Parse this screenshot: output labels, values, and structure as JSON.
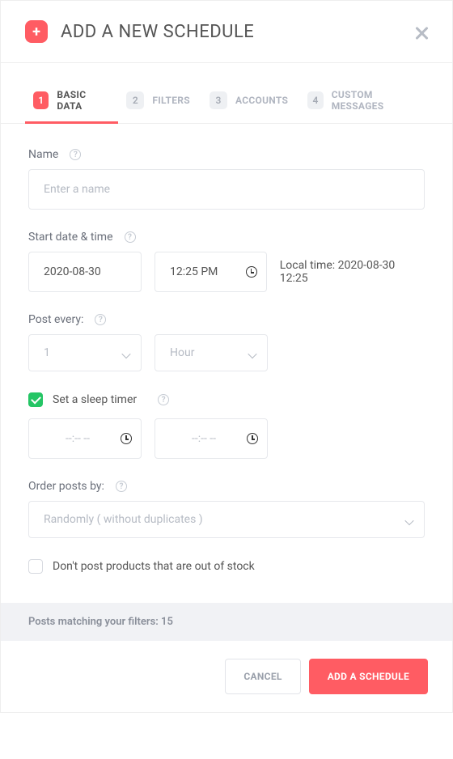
{
  "header": {
    "title": "ADD A NEW SCHEDULE"
  },
  "tabs": [
    {
      "num": "1",
      "label": "BASIC DATA",
      "active": true
    },
    {
      "num": "2",
      "label": "FILTERS"
    },
    {
      "num": "3",
      "label": "ACCOUNTS"
    },
    {
      "num": "4",
      "label": "CUSTOM MESSAGES"
    }
  ],
  "name": {
    "label": "Name",
    "placeholder": "Enter a name",
    "value": ""
  },
  "start": {
    "label": "Start date & time",
    "date_value": "2020-08-30",
    "time_value": "12:25 PM",
    "local_time": "Local time: 2020-08-30 12:25"
  },
  "post_every": {
    "label": "Post every:",
    "interval": "1",
    "unit": "Hour"
  },
  "sleep": {
    "label": "Set a sleep timer",
    "checked": true,
    "from_placeholder": "--:-- --",
    "to_placeholder": "--:-- --"
  },
  "order": {
    "label": "Order posts by:",
    "selected": "Randomly ( without duplicates )"
  },
  "outofstock": {
    "label": "Don't post products that are out of stock",
    "checked": false
  },
  "filters_bar": "Posts matching your filters: 15",
  "footer": {
    "cancel": "CANCEL",
    "submit": "ADD A SCHEDULE"
  }
}
